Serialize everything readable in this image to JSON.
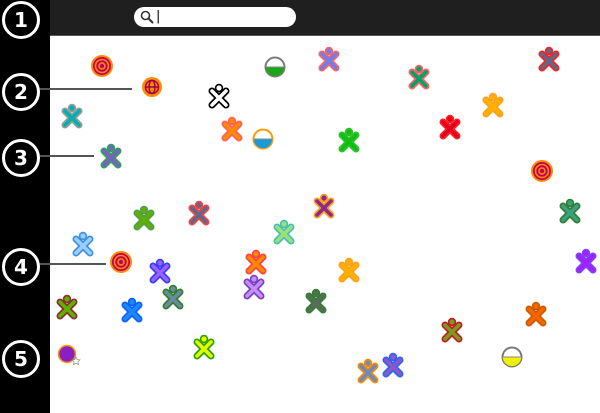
{
  "search": {
    "value": "",
    "placeholder": ""
  },
  "callouts": [
    "1",
    "2",
    "3",
    "4",
    "5"
  ],
  "icons": [
    {
      "name": "xo-buddy-icon",
      "kind": "xo",
      "stroke": "#9a9a9a",
      "fill": "#00b0b0"
    },
    {
      "name": "target-activity-icon",
      "kind": "target",
      "stroke": "#ff8a00",
      "fill": "#c00060"
    },
    {
      "name": "globe-activity-icon",
      "kind": "globe",
      "stroke": "#ff8a00",
      "fill": "#a0004a"
    },
    {
      "name": "xo-buddy-icon",
      "kind": "xo",
      "stroke": "#000000",
      "fill": "#ffffff"
    },
    {
      "name": "xo-buddy-icon",
      "kind": "xo",
      "stroke": "#ff6060",
      "fill": "#ff8a00"
    },
    {
      "name": "bucket-activity-icon",
      "kind": "bucket",
      "stroke": "#ff9900",
      "fill": "#1a9bd7"
    },
    {
      "name": "bucket-activity-icon",
      "kind": "bucket",
      "stroke": "#7a7a7a",
      "fill": "#1aa51a"
    },
    {
      "name": "xo-buddy-icon",
      "kind": "xo",
      "stroke": "#ff6060",
      "fill": "#6a7ff0"
    },
    {
      "name": "xo-buddy-icon",
      "kind": "xo",
      "stroke": "#ff6060",
      "fill": "#00a46a"
    },
    {
      "name": "xo-buddy-icon",
      "kind": "xo",
      "stroke": "#ff2020",
      "fill": "#5a6a8a"
    },
    {
      "name": "xo-buddy-icon",
      "kind": "xo",
      "stroke": "#ffa020",
      "fill": "#ffb000"
    },
    {
      "name": "xo-buddy-icon",
      "kind": "xo",
      "stroke": "#ff2020",
      "fill": "#e00020"
    },
    {
      "name": "xo-buddy-icon",
      "kind": "xo",
      "stroke": "#30c030",
      "fill": "#10c010"
    },
    {
      "name": "xo-buddy-icon",
      "kind": "xo",
      "stroke": "#30a060",
      "fill": "#7a60c0"
    },
    {
      "name": "target-activity-icon",
      "kind": "target",
      "stroke": "#ff8a00",
      "fill": "#c00060"
    },
    {
      "name": "xo-buddy-icon",
      "kind": "xo",
      "stroke": "#50a050",
      "fill": "#60b000"
    },
    {
      "name": "xo-buddy-icon",
      "kind": "xo",
      "stroke": "#ff4040",
      "fill": "#5a6a8a"
    },
    {
      "name": "xo-buddy-icon",
      "kind": "xo",
      "stroke": "#ffa020",
      "fill": "#8a2a8a"
    },
    {
      "name": "xo-buddy-icon",
      "kind": "xo",
      "stroke": "#40c0c0",
      "fill": "#a0e070"
    },
    {
      "name": "xo-buddy-icon",
      "kind": "xo",
      "stroke": "#308030",
      "fill": "#3aa080"
    },
    {
      "name": "xo-buddy-icon",
      "kind": "xo",
      "stroke": "#4090e0",
      "fill": "#9ad0ff"
    },
    {
      "name": "target-activity-icon",
      "kind": "target",
      "stroke": "#ff8a00",
      "fill": "#c00060"
    },
    {
      "name": "xo-buddy-icon",
      "kind": "xo",
      "stroke": "#3040ff",
      "fill": "#a060ff"
    },
    {
      "name": "xo-buddy-icon",
      "kind": "xo",
      "stroke": "#ff4040",
      "fill": "#ff8a00"
    },
    {
      "name": "xo-buddy-icon",
      "kind": "xo",
      "stroke": "#ffa020",
      "fill": "#ffb000"
    },
    {
      "name": "xo-buddy-icon",
      "kind": "xo",
      "stroke": "#8040c0",
      "fill": "#c090ff"
    },
    {
      "name": "xo-buddy-icon",
      "kind": "xo",
      "stroke": "#308030",
      "fill": "#6a8aa0"
    },
    {
      "name": "xo-buddy-icon",
      "kind": "xo",
      "stroke": "#8a3030",
      "fill": "#60b000"
    },
    {
      "name": "xo-buddy-icon",
      "kind": "xo",
      "stroke": "#1060ff",
      "fill": "#1a8aff"
    },
    {
      "name": "xo-buddy-icon",
      "kind": "xo",
      "stroke": "#308030",
      "fill": "#5a6a5a"
    },
    {
      "name": "xo-buddy-icon",
      "kind": "xo",
      "stroke": "#8040ff",
      "fill": "#a020ff"
    },
    {
      "name": "xo-buddy-icon",
      "kind": "xo",
      "stroke": "#c06000",
      "fill": "#ff6000"
    },
    {
      "name": "xo-buddy-icon",
      "kind": "xo",
      "stroke": "#c02020",
      "fill": "#7a9a20"
    },
    {
      "name": "xo-buddy-icon",
      "kind": "xo",
      "stroke": "#30a000",
      "fill": "#e0ff00"
    },
    {
      "name": "xo-buddy-icon",
      "kind": "xo",
      "stroke": "#ff8a00",
      "fill": "#6a8ac0"
    },
    {
      "name": "xo-buddy-icon",
      "kind": "xo",
      "stroke": "#3060ff",
      "fill": "#8a5ac0"
    },
    {
      "name": "bucket-activity-icon",
      "kind": "bucket",
      "stroke": "#7a7a7a",
      "fill": "#f0f000"
    },
    {
      "name": "palette-activity-icon",
      "kind": "dot",
      "stroke": "#ff9900",
      "fill": "#8a20c0"
    }
  ]
}
